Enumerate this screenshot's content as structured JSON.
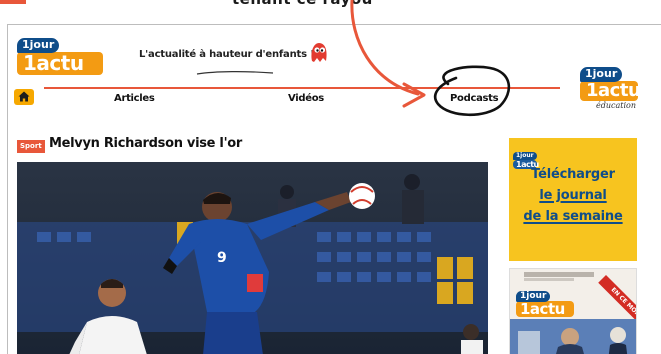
{
  "annotation": {
    "top_text": "tenant ce rayou",
    "arrow_color": "#e8573a",
    "circle_color": "#111111"
  },
  "header": {
    "logo_top": "1jour",
    "logo_bottom": "1actu",
    "tagline": "L'actualité à hauteur d'enfants !",
    "education_logo_top": "1jour",
    "education_logo_bottom": "1actu",
    "education_logo_sub": "éducation"
  },
  "nav": {
    "home_icon": "home-icon",
    "items": [
      "Articles",
      "Vidéos",
      "Podcasts"
    ]
  },
  "article": {
    "category": "Sport",
    "title": "Melvyn Richardson vise l'or"
  },
  "sidebar": {
    "ad_logo_top": "1jour",
    "ad_logo_bottom": "1actu",
    "ad_line1": "Télécharger",
    "ad_line2": "le journal",
    "ad_line3": "de la semaine",
    "cover_logo_top": "1jour",
    "cover_logo_bottom": "1actu",
    "cover_ribbon": "EN CE MOMENT"
  },
  "colors": {
    "accent": "#e8573a",
    "brand_orange": "#f39b13",
    "brand_blue": "#0f4d8a",
    "ad_yellow": "#f7c41f"
  }
}
